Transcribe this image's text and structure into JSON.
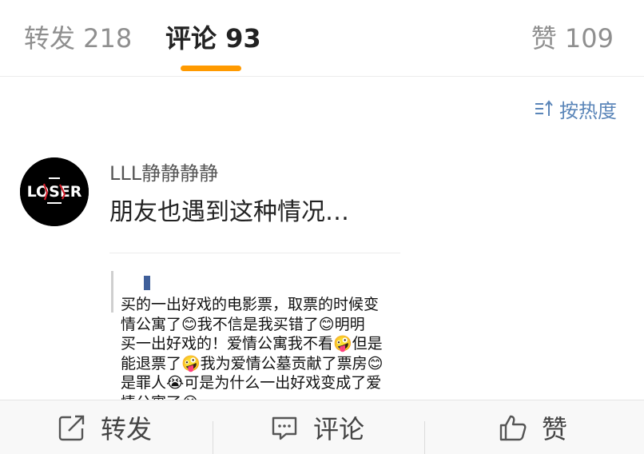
{
  "tabs": {
    "repost": "转发 218",
    "comment": "评论 93",
    "like": "赞 109"
  },
  "sort": {
    "label": "按热度",
    "icon": "sort-icon"
  },
  "comment": {
    "username": "LLL静静静静",
    "avatar_text": "LOSER",
    "text": "朋友也遇到这种情况…",
    "attachment_lines": [
      "买的一出好戏的电影票，取票的时候变",
      "情公寓了😊我不信是我买错了😊明明",
      "买一出好戏的！爱情公寓我不看🤪但是",
      "能退票了🤪我为爱情公墓贡献了票房😊",
      "是罪人😭可是为什么一出好戏变成了爱",
      "情公寓了😭"
    ]
  },
  "bottom_bar": {
    "repost": "转发",
    "comment": "评论",
    "like": "赞"
  },
  "colors": {
    "accent": "#ff9a00",
    "link": "#5b86b9"
  }
}
